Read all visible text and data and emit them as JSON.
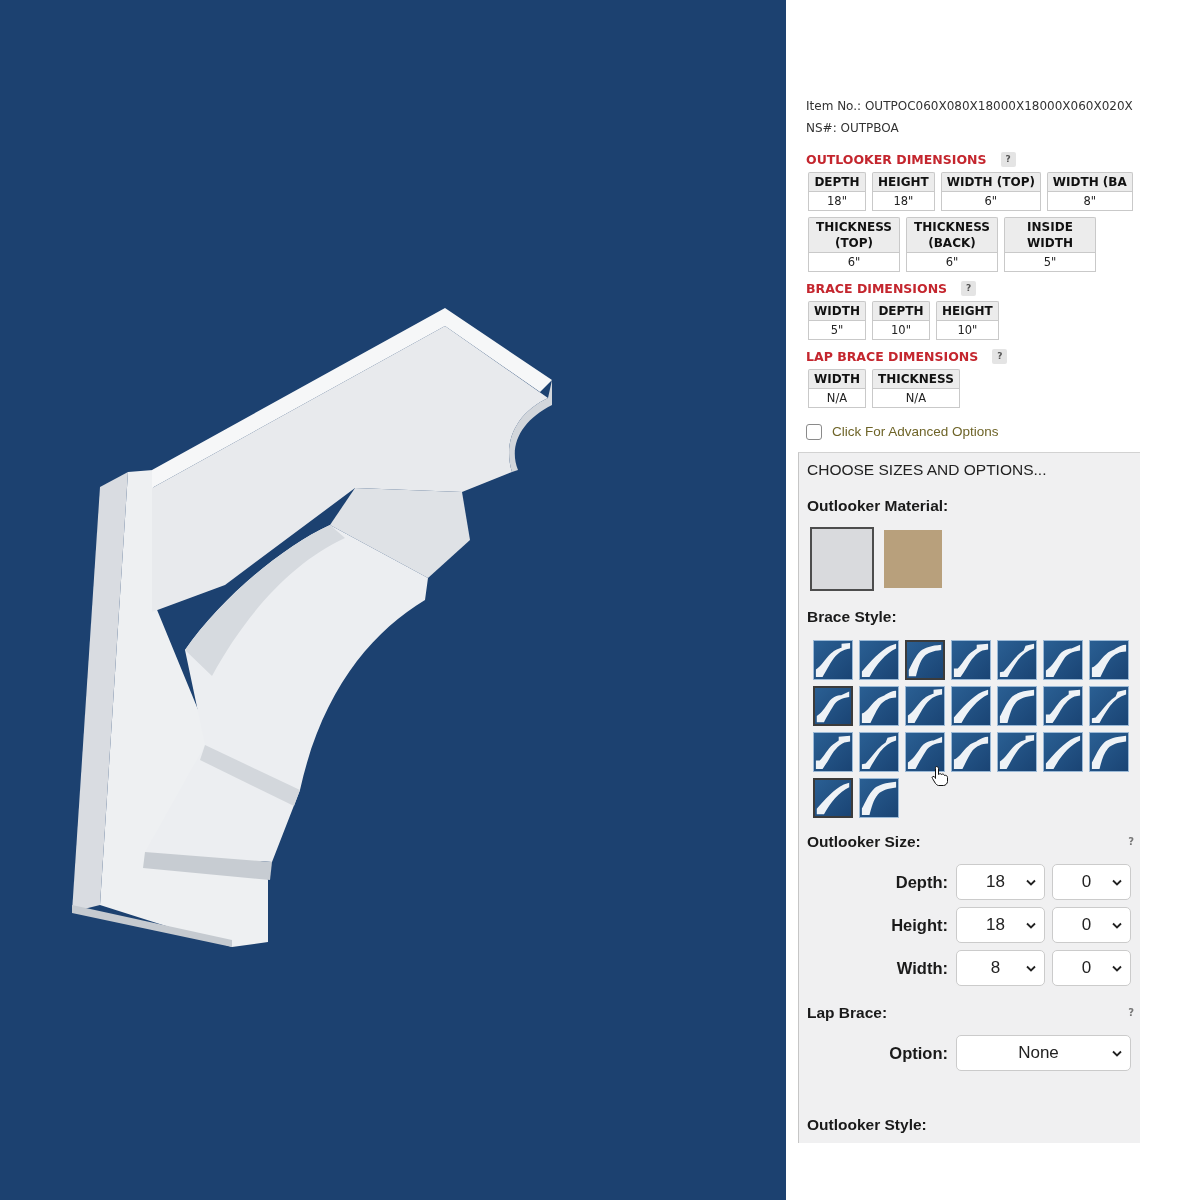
{
  "item": {
    "item_no": "Item No.: OUTPOC060X080X18000X18000X060X020X",
    "ns": "NS#: OUTPBOA"
  },
  "dimension_sections": [
    {
      "title": "OUTLOOKER DIMENSIONS",
      "help": "?",
      "rows": [
        {
          "cells": [
            {
              "label": "DEPTH",
              "value": "18\""
            },
            {
              "label": "HEIGHT",
              "value": "18\""
            },
            {
              "label": "WIDTH (TOP)",
              "value": "6\""
            },
            {
              "label": "WIDTH (BA",
              "value": "8\""
            }
          ]
        },
        {
          "cells": [
            {
              "label": "THICKNESS (TOP)",
              "value": "6\""
            },
            {
              "label": "THICKNESS (BACK)",
              "value": "6\""
            },
            {
              "label": "INSIDE WIDTH",
              "value": "5\""
            }
          ]
        }
      ]
    },
    {
      "title": "BRACE DIMENSIONS",
      "help": "?",
      "rows": [
        {
          "cells": [
            {
              "label": "WIDTH",
              "value": "5\""
            },
            {
              "label": "DEPTH",
              "value": "10\""
            },
            {
              "label": "HEIGHT",
              "value": "10\""
            }
          ]
        }
      ]
    },
    {
      "title": "LAP BRACE DIMENSIONS",
      "help": "?",
      "rows": [
        {
          "cells": [
            {
              "label": "WIDTH",
              "value": "N/A"
            },
            {
              "label": "THICKNESS",
              "value": "N/A"
            }
          ]
        }
      ]
    }
  ],
  "advanced_options": {
    "label": "Click For Advanced Options",
    "checked": false
  },
  "options_panel": {
    "title": "CHOOSE SIZES AND OPTIONS...",
    "material": {
      "label": "Outlooker Material:",
      "swatches": [
        {
          "color": "#d9dadd",
          "selected": true
        },
        {
          "color": "#b8a07c",
          "selected": false
        }
      ]
    },
    "brace_style": {
      "label": "Brace Style:",
      "tiles": [
        {
          "selected": false,
          "hovered": false
        },
        {
          "selected": false,
          "hovered": false
        },
        {
          "selected": true,
          "hovered": false
        },
        {
          "selected": false,
          "hovered": false
        },
        {
          "selected": false,
          "hovered": false
        },
        {
          "selected": false,
          "hovered": false
        },
        {
          "selected": false,
          "hovered": false
        },
        {
          "selected": true,
          "hovered": false
        },
        {
          "selected": false,
          "hovered": false
        },
        {
          "selected": false,
          "hovered": false
        },
        {
          "selected": false,
          "hovered": false
        },
        {
          "selected": false,
          "hovered": false
        },
        {
          "selected": false,
          "hovered": false
        },
        {
          "selected": false,
          "hovered": false
        },
        {
          "selected": false,
          "hovered": false
        },
        {
          "selected": false,
          "hovered": false
        },
        {
          "selected": false,
          "hovered": true
        },
        {
          "selected": false,
          "hovered": false
        },
        {
          "selected": false,
          "hovered": false
        },
        {
          "selected": false,
          "hovered": false
        },
        {
          "selected": false,
          "hovered": false
        },
        {
          "selected": true,
          "hovered": false
        },
        {
          "selected": false,
          "hovered": false
        }
      ]
    },
    "outlooker_size": {
      "label": "Outlooker Size:",
      "help": "?",
      "fields": [
        {
          "label": "Depth:",
          "values": [
            "18",
            "0"
          ]
        },
        {
          "label": "Height:",
          "values": [
            "18",
            "0"
          ]
        },
        {
          "label": "Width:",
          "values": [
            "8",
            "0"
          ]
        }
      ]
    },
    "lap_brace": {
      "label": "Lap Brace:",
      "help": "?",
      "fields": [
        {
          "label": "Option:",
          "values": [
            "None"
          ]
        }
      ]
    },
    "next_label": "Outlooker Style:"
  }
}
